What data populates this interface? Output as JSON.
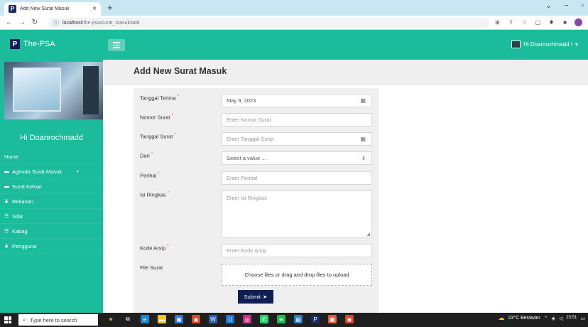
{
  "browser": {
    "tab_title": "Add New Surat Masuk",
    "url_host": "localhost",
    "url_path": "/the-psa/surat_masuk/add",
    "favicon_letter": "P"
  },
  "header": {
    "brand_logo_letter": "P",
    "brand": "The-PSA",
    "user_greeting": "Hi Doanrochmadd !"
  },
  "sidebar": {
    "user_name": "Hi Doanrochmadd",
    "items": [
      {
        "label": "Home",
        "icon": ""
      },
      {
        "label": "Agenda Surat Masuk",
        "icon": "envelope-icon"
      },
      {
        "label": "Surat Keluar",
        "icon": "envelope-icon"
      },
      {
        "label": "Rekanan",
        "icon": "user-icon"
      },
      {
        "label": "Sifat",
        "icon": "list-icon"
      },
      {
        "label": "Kabag",
        "icon": "list-icon"
      },
      {
        "label": "Pengguna",
        "icon": "user-icon"
      }
    ]
  },
  "page": {
    "title": "Add New Surat Masuk"
  },
  "form": {
    "tanggal_terima": {
      "label": "Tanggal Terima",
      "value": "May 9, 2023"
    },
    "nomor_surat": {
      "label": "Nomor Surat",
      "placeholder": "Enter Nomor Surat"
    },
    "tanggal_surat": {
      "label": "Tanggal Surat",
      "placeholder": "Enter Tanggal Surat"
    },
    "dari": {
      "label": "Dari",
      "value": "Select a value ..."
    },
    "perihal": {
      "label": "Perihal",
      "placeholder": "Enter Perihal"
    },
    "isi_ringkas": {
      "label": "Isi Ringkas",
      "placeholder": "Enter Isi Ringkas"
    },
    "kode_arsip": {
      "label": "Kode Arsip",
      "placeholder": "Enter Kode Arsip"
    },
    "file_surat": {
      "label": "File Surat",
      "dropzone_text": "Choose files or drag and drop files to upload"
    },
    "submit_label": "Submit",
    "required_mark": "*"
  },
  "taskbar": {
    "search_placeholder": "Type here to search",
    "weather": "23°C Berawan",
    "time": "23:51"
  },
  "colors": {
    "primary": "#1bbc9b",
    "navy": "#0f1f56",
    "required": "#e74c3c"
  }
}
